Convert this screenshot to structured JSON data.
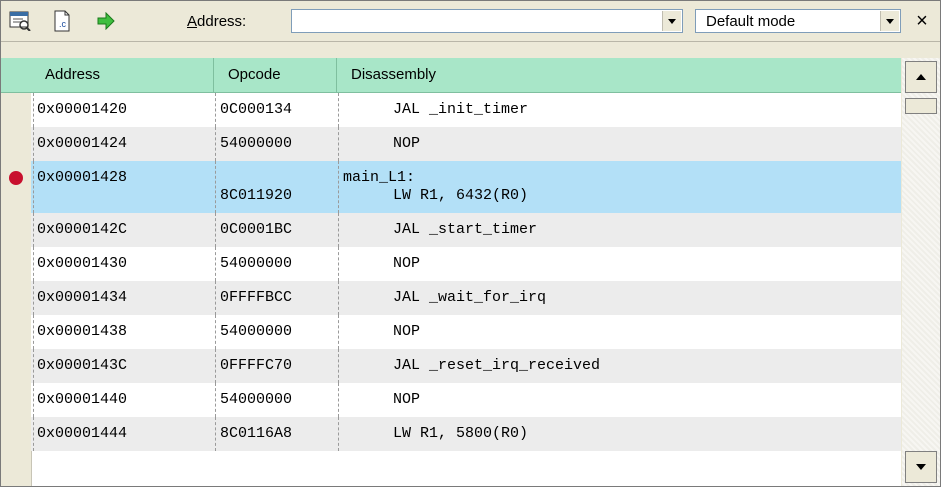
{
  "toolbar": {
    "address_label_prefix": "A",
    "address_label_rest": "ddress:",
    "address_value": "",
    "mode_value": "Default mode",
    "close_glyph": "×"
  },
  "columns": [
    "Address",
    "Opcode",
    "Disassembly"
  ],
  "rows": [
    {
      "address": "0x00001420",
      "opcode": "0C000134",
      "label": "",
      "instr": "JAL _init_timer",
      "breakpoint": false,
      "highlight": false
    },
    {
      "address": "0x00001424",
      "opcode": "54000000",
      "label": "",
      "instr": "NOP",
      "breakpoint": false,
      "highlight": false
    },
    {
      "address": "0x00001428",
      "opcode": "8C011920",
      "label": "main_L1:",
      "instr": "LW R1, 6432(R0)",
      "breakpoint": true,
      "highlight": true
    },
    {
      "address": "0x0000142C",
      "opcode": "0C0001BC",
      "label": "",
      "instr": "JAL _start_timer",
      "breakpoint": false,
      "highlight": false
    },
    {
      "address": "0x00001430",
      "opcode": "54000000",
      "label": "",
      "instr": "NOP",
      "breakpoint": false,
      "highlight": false
    },
    {
      "address": "0x00001434",
      "opcode": "0FFFFBCC",
      "label": "",
      "instr": "JAL _wait_for_irq",
      "breakpoint": false,
      "highlight": false
    },
    {
      "address": "0x00001438",
      "opcode": "54000000",
      "label": "",
      "instr": "NOP",
      "breakpoint": false,
      "highlight": false
    },
    {
      "address": "0x0000143C",
      "opcode": "0FFFFC70",
      "label": "",
      "instr": "JAL _reset_irq_received",
      "breakpoint": false,
      "highlight": false
    },
    {
      "address": "0x00001440",
      "opcode": "54000000",
      "label": "",
      "instr": "NOP",
      "breakpoint": false,
      "highlight": false
    },
    {
      "address": "0x00001444",
      "opcode": "8C0116A8",
      "label": "",
      "instr": "LW R1, 5800(R0)",
      "breakpoint": false,
      "highlight": false
    }
  ],
  "colors": {
    "header_bg": "#a8e6c8",
    "row_alt_bg": "#ececec",
    "highlight_bg": "#b3e0f7",
    "breakpoint": "#c8102e"
  },
  "icons": [
    "disassembly-window-icon",
    "source-file-icon",
    "go-arrow-icon",
    "combo-dropdown-icon",
    "close-icon",
    "scroll-up-icon",
    "scroll-down-icon"
  ]
}
